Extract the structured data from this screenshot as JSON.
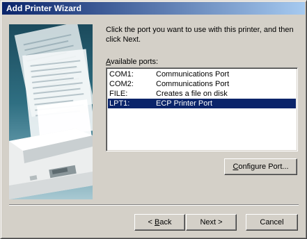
{
  "window": {
    "title": "Add Printer Wizard"
  },
  "instructions": "Click the port you want to use with this printer, and then click Next.",
  "ports": {
    "label_accel": "A",
    "label_rest": "vailable ports:",
    "items": [
      {
        "port": "COM1:",
        "description": "Communications Port",
        "selected": false
      },
      {
        "port": "COM2:",
        "description": "Communications Port",
        "selected": false
      },
      {
        "port": "FILE:",
        "description": "Creates a file on disk",
        "selected": false
      },
      {
        "port": "LPT1:",
        "description": "ECP Printer Port",
        "selected": true
      }
    ]
  },
  "buttons": {
    "configure_accel": "C",
    "configure_rest": "onfigure Port...",
    "back_prefix": "< ",
    "back_accel": "B",
    "back_rest": "ack",
    "next": "Next >",
    "cancel": "Cancel"
  },
  "colors": {
    "dialog_face": "#d4d0c8",
    "titlebar_start": "#0a246a",
    "titlebar_end": "#a6caf0",
    "selection": "#0a246a"
  }
}
